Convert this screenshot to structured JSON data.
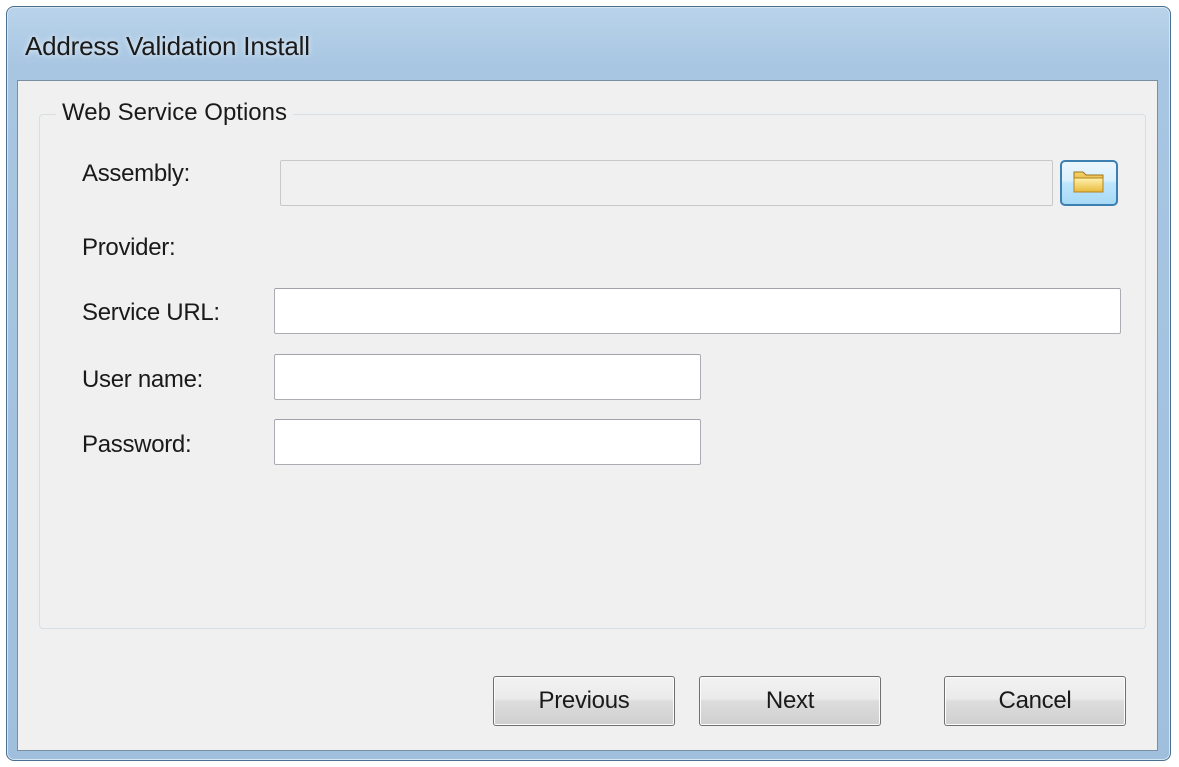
{
  "window": {
    "title": "Address Validation Install"
  },
  "group": {
    "legend": "Web Service Options"
  },
  "fields": {
    "assembly": {
      "label": "Assembly:",
      "value": ""
    },
    "provider": {
      "label": "Provider:"
    },
    "service_url": {
      "label": "Service URL:",
      "value": ""
    },
    "user_name": {
      "label": "User name:",
      "value": ""
    },
    "password": {
      "label": "Password:",
      "value": ""
    }
  },
  "buttons": {
    "previous": "Previous",
    "next": "Next",
    "cancel": "Cancel"
  },
  "icons": {
    "browse": "folder-icon"
  }
}
